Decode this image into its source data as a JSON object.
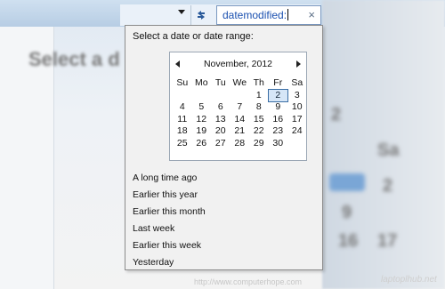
{
  "search": {
    "query": "datemodified:",
    "clear_glyph": "×"
  },
  "icons": {
    "dropdown": "chevron-down-icon",
    "refresh": "refresh-icon",
    "clear": "close-icon"
  },
  "popup": {
    "title": "Select a date or date range:"
  },
  "calendar": {
    "month_label": "November, 2012",
    "weekdays": [
      "Su",
      "Mo",
      "Tu",
      "We",
      "Th",
      "Fr",
      "Sa"
    ],
    "days": [
      "",
      "",
      "",
      "",
      "1",
      "2",
      "3",
      "4",
      "5",
      "6",
      "7",
      "8",
      "9",
      "10",
      "11",
      "12",
      "13",
      "14",
      "15",
      "16",
      "17",
      "18",
      "19",
      "20",
      "21",
      "22",
      "23",
      "24",
      "25",
      "26",
      "27",
      "28",
      "29",
      "30",
      ""
    ],
    "selected_day": "2"
  },
  "ranges": [
    "A long time ago",
    "Earlier this year",
    "Earlier this month",
    "Last week",
    "Earlier this week",
    "Yesterday"
  ],
  "background": {
    "title_fragment": "Select a d",
    "calendar_fragments": [
      "2",
      "Sa",
      "2",
      "9",
      "16",
      "17"
    ]
  },
  "watermarks": {
    "url": "http://www.computerhope.com",
    "logo": "laptoplhub.net"
  },
  "colors": {
    "accent": "#3a6ea5",
    "search_text": "#1a50b0"
  }
}
